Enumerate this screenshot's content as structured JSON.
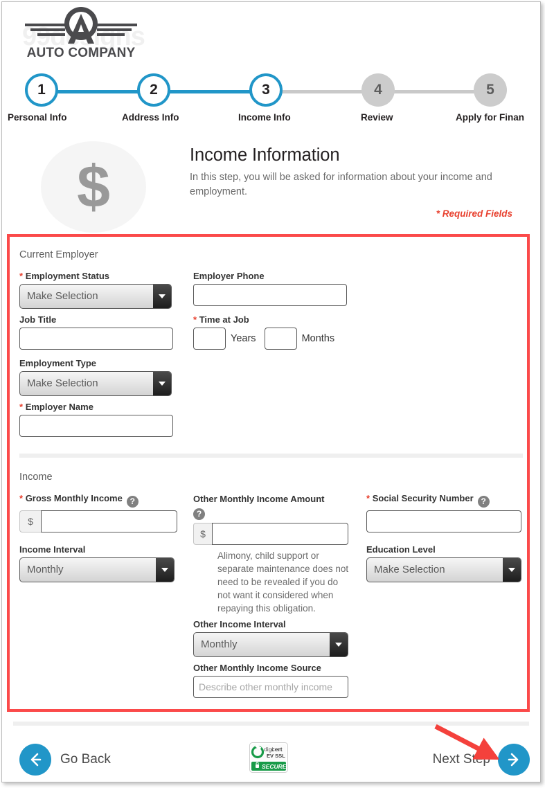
{
  "brand": {
    "watermark": "99designs",
    "company_name": "AUTO COMPANY",
    "logo_icon": "winged-a-emblem"
  },
  "stepper": {
    "active_step": 3,
    "steps": [
      {
        "number": "1",
        "label": "Personal Info",
        "state": "active"
      },
      {
        "number": "2",
        "label": "Address Info",
        "state": "active"
      },
      {
        "number": "3",
        "label": "Income Info",
        "state": "active"
      },
      {
        "number": "4",
        "label": "Review",
        "state": "inactive"
      },
      {
        "number": "5",
        "label": "Apply for Finan",
        "state": "inactive"
      }
    ]
  },
  "intro": {
    "icon": "dollar-sign-icon",
    "dollar_glyph": "$",
    "title": "Income Information",
    "description": "In this step, you will be asked for information about your income and employment.",
    "required_note": "* Required Fields"
  },
  "form": {
    "employer_section": {
      "title": "Current Employer",
      "employment_status": {
        "label": "Employment Status",
        "required": true,
        "value": "Make Selection"
      },
      "employer_phone": {
        "label": "Employer Phone",
        "required": false,
        "value": ""
      },
      "job_title": {
        "label": "Job Title",
        "required": false,
        "value": ""
      },
      "time_at_job": {
        "label": "Time at Job",
        "required": true,
        "years_value": "",
        "years_unit": "Years",
        "months_value": "",
        "months_unit": "Months"
      },
      "employment_type": {
        "label": "Employment Type",
        "required": false,
        "value": "Make Selection"
      },
      "employer_name": {
        "label": "Employer Name",
        "required": true,
        "value": ""
      }
    },
    "income_section": {
      "title": "Income",
      "gross_monthly_income": {
        "label": "Gross Monthly Income",
        "required": true,
        "prefix": "$",
        "value": "",
        "help": "?"
      },
      "income_interval": {
        "label": "Income Interval",
        "required": false,
        "value": "Monthly"
      },
      "other_monthly_income_amount": {
        "label": "Other Monthly Income Amount",
        "required": false,
        "prefix": "$",
        "value": "",
        "help": "?",
        "hint": "Alimony, child support or separate maintenance does not need to be revealed if you do not want it considered when repaying this obligation."
      },
      "other_income_interval": {
        "label": "Other Income Interval",
        "required": false,
        "value": "Monthly"
      },
      "other_monthly_income_source": {
        "label": "Other Monthly Income Source",
        "required": false,
        "value": "",
        "placeholder": "Describe other monthly income"
      },
      "social_security_number": {
        "label": "Social Security Number",
        "required": true,
        "value": "",
        "help": "?"
      },
      "education_level": {
        "label": "Education Level",
        "required": false,
        "value": "Make Selection"
      }
    }
  },
  "footer": {
    "go_back_label": "Go Back",
    "go_back_icon": "arrow-left-icon",
    "next_step_label": "Next Step",
    "next_step_icon": "arrow-right-icon",
    "seal": {
      "brand_light": "digi",
      "brand_bold": "cert",
      "cert_type": "EV SSL",
      "secure_label": "SECURE",
      "lock_icon": "lock-icon"
    }
  },
  "annotation": {
    "arrow_icon": "red-pointer-arrow",
    "target": "next-step-button"
  },
  "colors": {
    "accent_blue": "#2196c8",
    "highlight_red": "#fb4a4a",
    "required_red": "#e8412f",
    "inactive_gray": "#cccccc",
    "seal_green": "#199b49"
  }
}
